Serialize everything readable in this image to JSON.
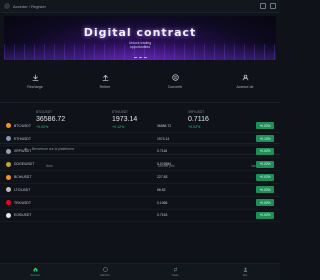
{
  "header": {
    "account_text": "Accéder / Register"
  },
  "banner": {
    "title": "Digital contract",
    "subtitle_line1": "Unlock trading",
    "subtitle_line2": "opportunities"
  },
  "actions": [
    {
      "label": "Recharge",
      "icon": "download-icon"
    },
    {
      "label": "Retirer",
      "icon": "upload-icon"
    },
    {
      "label": "Convertir",
      "icon": "exchange-icon"
    },
    {
      "label": "Avance de",
      "icon": "user-icon"
    }
  ],
  "tickers": [
    {
      "symbol": "BTC/USDT",
      "price": "36586.72",
      "change": "+0.02%"
    },
    {
      "symbol": "ETH/USDT",
      "price": "1973.14",
      "change": "+0.12%"
    },
    {
      "symbol": "XRP/USDT",
      "price": "0.7116",
      "change": "+0.02%"
    }
  ],
  "notice": {
    "text": "Bienvenue sur la plateforme"
  },
  "table": {
    "headers": {
      "name": "Nom",
      "price": "Dernier prix",
      "change": "Variation du jour"
    },
    "rows": [
      {
        "pair": "BTC/USDT",
        "price": "36586.72",
        "change": "+0.02%",
        "color": "#f7931a"
      },
      {
        "pair": "ETH/USDT",
        "price": "1973.14",
        "change": "+0.12%",
        "color": "#8a92b2"
      },
      {
        "pair": "XRP/USDT",
        "price": "0.7116",
        "change": "+0.02%",
        "color": "#9aa3ad"
      },
      {
        "pair": "DOGE/USDT",
        "price": "0.076584",
        "change": "+0.02%",
        "color": "#c2a633"
      },
      {
        "pair": "BCH/USDT",
        "price": "227.83",
        "change": "+0.02%",
        "color": "#f7931a"
      },
      {
        "pair": "LTC/USDT",
        "price": "68.82",
        "change": "+0.02%",
        "color": "#bfbbbb"
      },
      {
        "pair": "TRX/USDT",
        "price": "0.1066",
        "change": "+0.02%",
        "color": "#ef0027"
      },
      {
        "pair": "EOS/USDT",
        "price": "0.7163",
        "change": "+0.02%",
        "color": "#e3e6ea"
      }
    ]
  },
  "bottom_nav": [
    {
      "label": "Accueil",
      "icon": "home-icon",
      "active": true
    },
    {
      "label": "Marché",
      "icon": "chart-icon",
      "active": false
    },
    {
      "label": "Trade",
      "icon": "swap-icon",
      "active": false
    },
    {
      "label": "Moi",
      "icon": "profile-icon",
      "active": false
    }
  ],
  "colors": {
    "accent": "#22c07a",
    "background": "#0f1319",
    "badge": "#1f8f5a"
  }
}
